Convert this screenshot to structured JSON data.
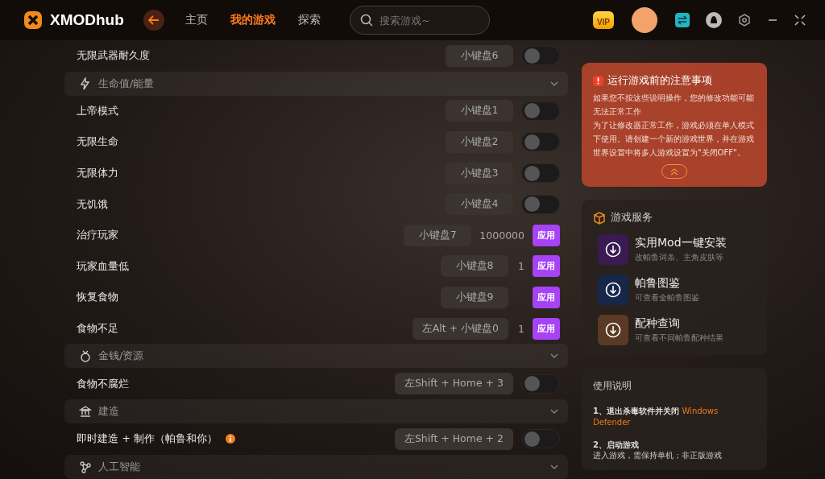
{
  "header": {
    "logo": "XMODhub",
    "tabs": [
      {
        "label": "主页",
        "selected": false
      },
      {
        "label": "我的游戏",
        "selected": true
      },
      {
        "label": "探索",
        "selected": false
      }
    ],
    "search": {
      "placeholder": "搜索游戏~"
    },
    "vip": "VIP"
  },
  "cheats": [
    {
      "kind": "toggle",
      "label": "无限武器耐久度",
      "hotkey": "小键盘6",
      "on": false
    },
    {
      "kind": "section",
      "label": "生命值/能量",
      "expanded": true
    },
    {
      "kind": "toggle",
      "label": "上帝模式",
      "hotkey": "小键盘1",
      "on": false
    },
    {
      "kind": "toggle",
      "label": "无限生命",
      "hotkey": "小键盘2",
      "on": false
    },
    {
      "kind": "toggle",
      "label": "无限体力",
      "hotkey": "小键盘3",
      "on": false
    },
    {
      "kind": "toggle",
      "label": "无饥饿",
      "hotkey": "小键盘4",
      "on": false
    },
    {
      "kind": "apply",
      "label": "治疗玩家",
      "hotkey": "小键盘7",
      "value": "1000000",
      "button": "应用"
    },
    {
      "kind": "apply",
      "label": "玩家血量低",
      "hotkey": "小键盘8",
      "value": "1",
      "button": "应用"
    },
    {
      "kind": "apply",
      "label": "恢复食物",
      "hotkey": "小键盘9",
      "button": "应用"
    },
    {
      "kind": "apply",
      "label": "食物不足",
      "hotkey": "左Alt + 小键盘0",
      "value": "1",
      "button": "应用"
    },
    {
      "kind": "section",
      "label": "金钱/资源",
      "expanded": true
    },
    {
      "kind": "toggle",
      "label": "食物不腐烂",
      "hotkey": "左Shift + Home + 3",
      "on": false
    },
    {
      "kind": "section",
      "label": "建造",
      "expanded": true
    },
    {
      "kind": "toggle",
      "label": "即时建造 + 制作（帕鲁和你）",
      "info": true,
      "hotkey": "左Shift + Home + 2",
      "on": false
    },
    {
      "kind": "section",
      "label": "人工智能",
      "expanded": true
    }
  ],
  "notice": {
    "title": "运行游戏前的注意事项",
    "paragraphs": [
      "如果您不按这些说明操作，您的修改功能可能无法正常工作",
      "为了让修改器正常工作，游戏必须在单人模式下使用。请创建一个新的游戏世界，并在游戏世界设置中将多人游戏设置为\"关闭OFF\"。"
    ],
    "expanded": true
  },
  "services": {
    "title": "游戏服务",
    "items": [
      {
        "title": "实用Mod一键安装",
        "subtitle": "改帕鲁词条、主角皮肤等",
        "color": "#3a1a52"
      },
      {
        "title": "帕鲁图鉴",
        "subtitle": "可查看全帕鲁图鉴",
        "color": "#16284a"
      },
      {
        "title": "配种查询",
        "subtitle": "可查看不同帕鲁配种结果",
        "color": "#5a3a24"
      }
    ]
  },
  "usage": {
    "title": "使用说明",
    "steps": [
      {
        "text": "1、退出杀毒软件并关闭",
        "highlight": "Windows Defender"
      },
      {
        "text": "2、启动游戏",
        "detail": "进入游戏，需保持单机；非正版游戏"
      }
    ]
  }
}
